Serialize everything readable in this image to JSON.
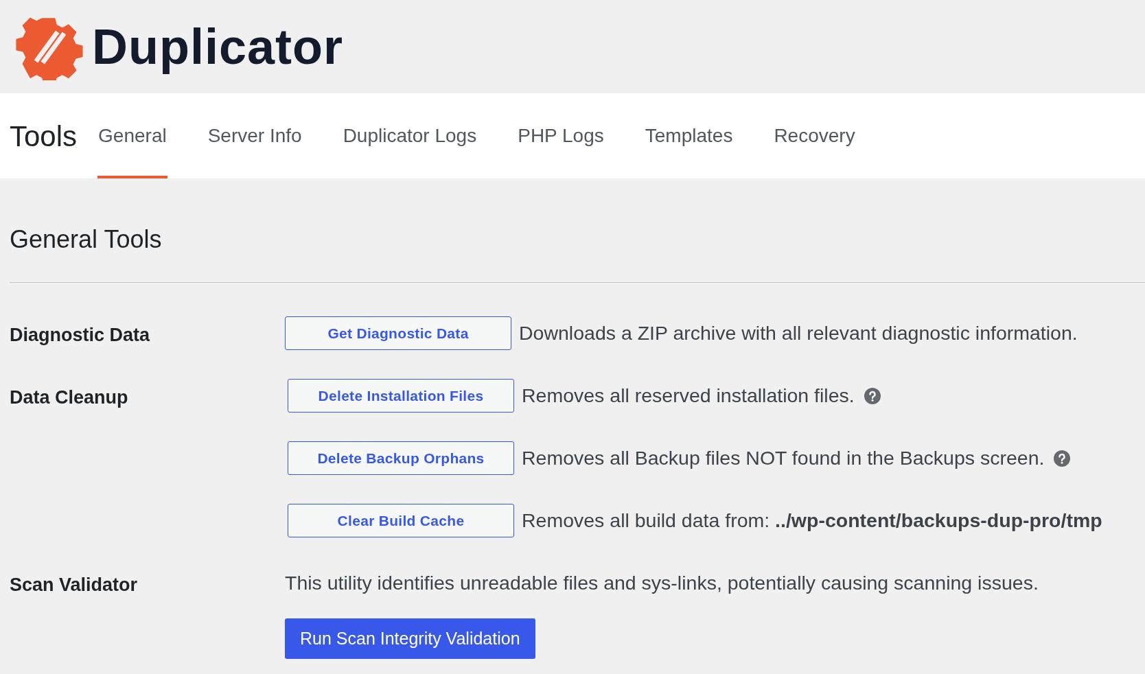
{
  "brand": {
    "name": "Duplicator"
  },
  "page_title": "Tools",
  "tabs": [
    {
      "label": "General",
      "selected": true
    },
    {
      "label": "Server Info",
      "selected": false
    },
    {
      "label": "Duplicator Logs",
      "selected": false
    },
    {
      "label": "PHP Logs",
      "selected": false
    },
    {
      "label": "Templates",
      "selected": false
    },
    {
      "label": "Recovery",
      "selected": false
    }
  ],
  "section_title": "General Tools",
  "rows": [
    {
      "kind": "actions",
      "label": "Diagnostic Data",
      "items": [
        {
          "button": "Get Diagnostic Data",
          "description": "Downloads a ZIP archive with all relevant diagnostic information.",
          "help": false
        }
      ]
    },
    {
      "kind": "actions",
      "label": "Data Cleanup",
      "items": [
        {
          "button": "Delete Installation Files",
          "description": "Removes all reserved installation files.",
          "help": true
        },
        {
          "button": "Delete Backup Orphans",
          "description": "Removes all Backup files NOT found in the Backups screen.",
          "help": true
        },
        {
          "button": "Clear Build Cache",
          "description": "Removes all build data from:  **../wp-content/backups-dup-pro/tmp**",
          "help": false
        }
      ]
    },
    {
      "kind": "validator",
      "label": "Scan Validator",
      "description": "This utility identifies unreadable files and sys-links, potentially causing scanning issues.",
      "button": "Run Scan Integrity Validation"
    }
  ]
}
